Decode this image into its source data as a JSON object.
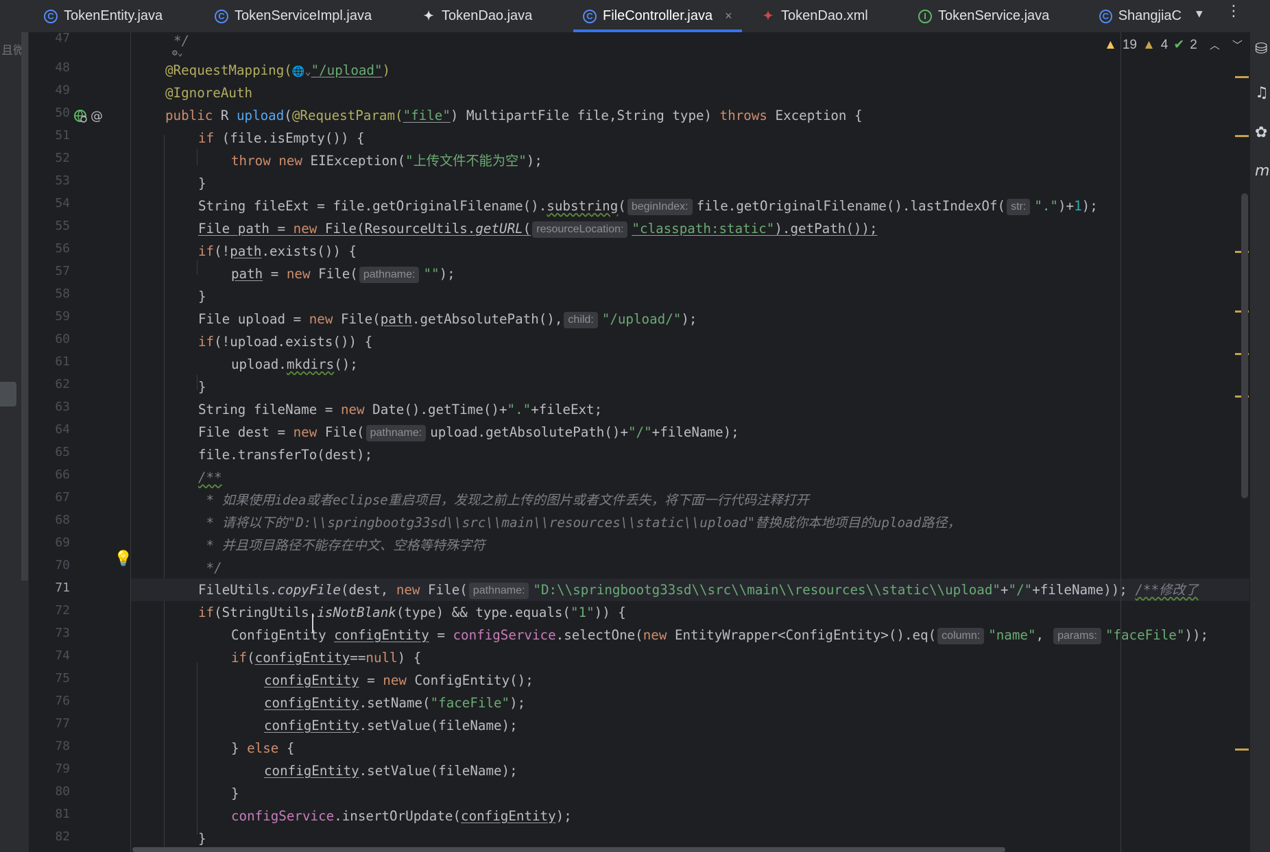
{
  "tabs": [
    {
      "label": "TokenEntity.java",
      "icon": "class-icon"
    },
    {
      "label": "TokenServiceImpl.java",
      "icon": "class-icon"
    },
    {
      "label": "TokenDao.java",
      "icon": "mybatis-icon"
    },
    {
      "label": "FileController.java",
      "icon": "class-icon",
      "active": true
    },
    {
      "label": "TokenDao.xml",
      "icon": "mybatis-xml-icon"
    },
    {
      "label": "TokenService.java",
      "icon": "interface-icon"
    },
    {
      "label": "ShangjiaC",
      "icon": "class-icon"
    }
  ],
  "sidebar": {
    "label": "且微"
  },
  "inspections": {
    "errors": "19",
    "warnings": "4",
    "ok": "2"
  },
  "line_numbers": [
    "47",
    "48",
    "49",
    "50",
    "51",
    "52",
    "53",
    "54",
    "55",
    "56",
    "57",
    "58",
    "59",
    "60",
    "61",
    "62",
    "63",
    "64",
    "65",
    "66",
    "67",
    "68",
    "69",
    "70",
    "71",
    "72",
    "73",
    "74",
    "75",
    "76",
    "77",
    "78",
    "79",
    "80",
    "81",
    "82"
  ],
  "current_line": "71",
  "code": {
    "l47": "*/",
    "l48a": "@RequestMapping(",
    "l48b": "\"/upload\"",
    "l48c": ")",
    "l49": "@IgnoreAuth",
    "l50a": "public",
    "l50b": " R ",
    "l50c": "upload",
    "l50d": "(",
    "l50e": "@RequestParam(",
    "l50f": "\"file\"",
    "l50g": ") MultipartFile file,String type) ",
    "l50h": "throws",
    "l50i": " Exception {",
    "l51a": "if",
    "l51b": " (file.isEmpty()) {",
    "l52a": "throw",
    "l52b": " ",
    "l52c": "new",
    "l52d": " EIException(",
    "l52e": "\"上传文件不能为空\"",
    "l52f": ");",
    "l53": "}",
    "l54a": "String fileExt = file.getOriginalFilename().",
    "l54b": "substring",
    "l54c": "(",
    "l54h": "beginIndex:",
    "l54d": "file.getOriginalFilename().lastIndexOf(",
    "l54h2": "str:",
    "l54e": "\".\"",
    "l54f": ")+",
    "l54g": "1",
    "l54i": ");",
    "l55a": "File",
    "l55b": " ",
    "l55c": "path",
    "l55d": " = ",
    "l55e": "new",
    "l55f": " File(ResourceUtils.",
    "l55g": "getURL",
    "l55h": "(",
    "l55hint": "resourceLocation:",
    "l55i": "\"classpath:static\"",
    "l55j": ").getPath());",
    "l56a": "if",
    "l56b": "(!",
    "l56c": "path",
    "l56d": ".exists()) {",
    "l57a": "path",
    "l57b": " = ",
    "l57c": "new",
    "l57d": " File(",
    "l57hint": "pathname:",
    "l57e": "\"\"",
    "l57f": ");",
    "l58": "}",
    "l59a": "File upload = ",
    "l59b": "new",
    "l59c": " File(",
    "l59d": "path",
    "l59e": ".getAbsolutePath(),",
    "l59hint": "child:",
    "l59f": "\"/upload/\"",
    "l59g": ");",
    "l60a": "if",
    "l60b": "(!upload.exists()) {",
    "l61a": "upload.",
    "l61b": "mkdirs",
    "l61c": "();",
    "l62": "}",
    "l63a": "String fileName = ",
    "l63b": "new",
    "l63c": " Date().getTime()+",
    "l63d": "\".\"",
    "l63e": "+fileExt;",
    "l64a": "File dest = ",
    "l64b": "new",
    "l64c": " File(",
    "l64hint": "pathname:",
    "l64d": "upload.getAbsolutePath()+",
    "l64e": "\"/\"",
    "l64f": "+fileName);",
    "l65": "file.transferTo(dest);",
    "l66": "/**",
    "l67": " * 如果使用idea或者eclipse重启项目，发现之前上传的图片或者文件丢失，将下面一行代码注释打开",
    "l68": " * 请将以下的\"D:\\\\springbootg33sd\\\\src\\\\main\\\\resources\\\\static\\\\upload\"替换成你本地项目的upload路径，",
    "l69": " * 并且项目路径不能存在中文、空格等特殊字符",
    "l70": " */",
    "l71a": "FileUtils.",
    "l71b": "copyFile",
    "l71c": "(dest, ",
    "l71d": "new",
    "l71e": " File(",
    "l71hint": "pathname:",
    "l71f": "\"D:\\\\springbootg33sd\\\\src\\\\main\\\\resources\\\\static\\\\upload\"",
    "l71g": "+",
    "l71h": "\"/\"",
    "l71i": "+fileName)); ",
    "l71j": "/**修改了",
    "l72a": "if",
    "l72b": "(StringUtils.",
    "l72c": "isNotBlank",
    "l72d": "(type) && type.equals(",
    "l72e": "\"1\"",
    "l72f": ")) {",
    "l73a": "ConfigEntity ",
    "l73b": "configEntity",
    "l73c": " = ",
    "l73d": "configService",
    "l73e": ".selectOne(",
    "l73f": "new",
    "l73g": " EntityWrapper<ConfigEntity>().eq(",
    "l73hint": "column:",
    "l73h": "\"name\"",
    "l73i": ",",
    "l73hint2": "params:",
    "l73j": "\"faceFile\"",
    "l73k": "));",
    "l74a": "if",
    "l74b": "(",
    "l74c": "configEntity",
    "l74d": "==",
    "l74e": "null",
    "l74f": ") {",
    "l75a": "configEntity",
    "l75b": " = ",
    "l75c": "new",
    "l75d": " ConfigEntity();",
    "l76a": "configEntity",
    "l76b": ".setName(",
    "l76c": "\"faceFile\"",
    "l76d": ");",
    "l77a": "configEntity",
    "l77b": ".setValue(fileName);",
    "l78a": "} ",
    "l78b": "else",
    "l78c": " {",
    "l79a": "configEntity",
    "l79b": ".setValue(fileName);",
    "l80": "}",
    "l81a": "configService",
    "l81b": ".insertOrUpdate(",
    "l81c": "configEntity",
    "l81d": ");",
    "l82": "}"
  }
}
